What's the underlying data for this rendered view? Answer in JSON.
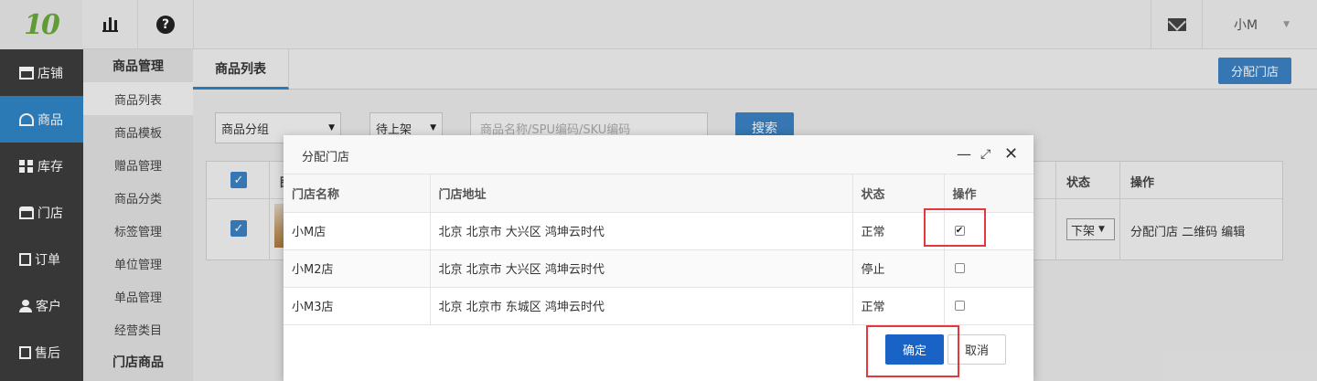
{
  "topbar": {
    "logo_text": "10",
    "user_name": "小M",
    "icons": [
      "bar-chart-icon",
      "help-icon",
      "mail-icon",
      "caret-down-icon"
    ]
  },
  "sidebar": {
    "items": [
      {
        "label": "店铺",
        "icon": "store-icon"
      },
      {
        "label": "商品",
        "icon": "goods-icon",
        "active": true
      },
      {
        "label": "库存",
        "icon": "grid-icon"
      },
      {
        "label": "门店",
        "icon": "shop-icon"
      },
      {
        "label": "订单",
        "icon": "order-icon"
      },
      {
        "label": "客户",
        "icon": "person-icon"
      },
      {
        "label": "售后",
        "icon": "service-icon"
      }
    ]
  },
  "subnav": {
    "heading": "商品管理",
    "items": [
      "商品列表",
      "商品模板",
      "赠品管理",
      "商品分类",
      "标签管理",
      "单位管理",
      "单品管理",
      "经营类目"
    ],
    "heading2": "门店商品"
  },
  "main": {
    "tab_label": "商品列表",
    "assign_button": "分配门店",
    "filters": {
      "group": "商品分组",
      "status": "待上架",
      "search_placeholder": "商品名称/SPU编码/SKU编码",
      "search_button": "搜索"
    },
    "table": {
      "header_image_partial": "图",
      "header_status": "状态",
      "header_ops": "操作",
      "row_status_select": "下架",
      "row_ops": "分配门店 二维码 编辑"
    }
  },
  "modal": {
    "title": "分配门店",
    "columns": [
      "门店名称",
      "门店地址",
      "状态",
      "操作"
    ],
    "rows": [
      {
        "name": "小M店",
        "address": "北京 北京市 大兴区 鸿坤云时代",
        "status": "正常",
        "checked": true
      },
      {
        "name": "小M2店",
        "address": "北京 北京市 大兴区 鸿坤云时代",
        "status": "停止",
        "checked": false
      },
      {
        "name": "小M3店",
        "address": "北京 北京市 东城区 鸿坤云时代",
        "status": "正常",
        "checked": false
      }
    ],
    "ok_label": "确定",
    "cancel_label": "取消"
  },
  "colors": {
    "accent": "#2f85c5",
    "primary_button": "#1a63c6",
    "highlight_box": "#e3393c",
    "sidebar_bg": "#3c3c3c"
  }
}
